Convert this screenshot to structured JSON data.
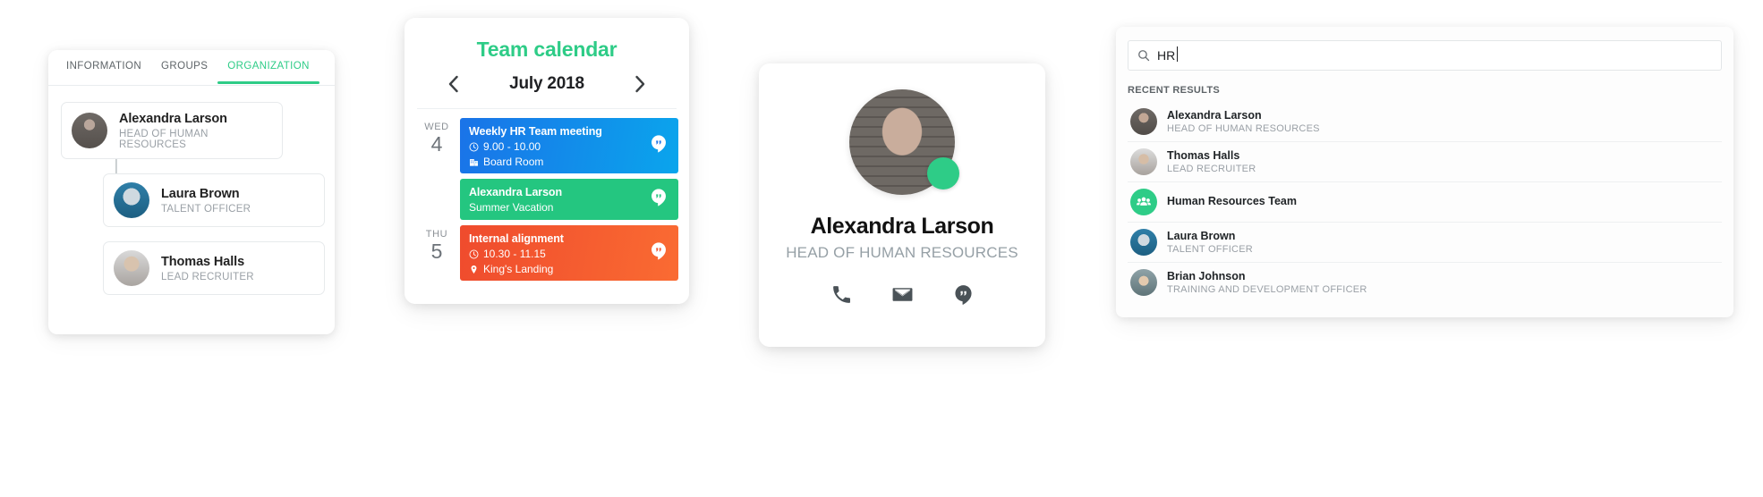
{
  "org_card": {
    "tabs": [
      {
        "label": "INFORMATION",
        "active": false
      },
      {
        "label": "GROUPS",
        "active": false
      },
      {
        "label": "ORGANIZATION",
        "active": true
      }
    ],
    "accent_color": "#2ecc87",
    "tree": [
      {
        "name": "Alexandra Larson",
        "role": "HEAD OF HUMAN RESOURCES",
        "level": 0
      },
      {
        "name": "Laura Brown",
        "role": "TALENT OFFICER",
        "level": 1
      },
      {
        "name": "Thomas Halls",
        "role": "LEAD RECRUITER",
        "level": 1
      }
    ]
  },
  "calendar": {
    "title": "Team calendar",
    "title_color": "#2ecc87",
    "month": "July 2018",
    "prev_icon": "chevron-left-icon",
    "next_icon": "chevron-right-icon",
    "days": [
      {
        "dow": "WED",
        "num": "4",
        "events": [
          {
            "title": "Weekly HR Team meeting",
            "time": "9.00 - 10.00",
            "location": "Board Room",
            "location_icon": "building-icon",
            "color": "#1a73e8",
            "style": "blue",
            "hangout": true
          },
          {
            "title": "Alexandra Larson",
            "time": "",
            "location": "Summer Vacation",
            "location_icon": "",
            "color": "#24c680",
            "style": "green",
            "hangout": true
          }
        ]
      },
      {
        "dow": "THU",
        "num": "5",
        "events": [
          {
            "title": "Internal alignment",
            "time": "10.30 - 11.15",
            "location": "King's Landing",
            "location_icon": "map-pin-icon",
            "color": "#ef4b2d",
            "style": "red",
            "hangout": true
          }
        ]
      }
    ]
  },
  "profile": {
    "name": "Alexandra Larson",
    "role": "HEAD OF HUMAN RESOURCES",
    "status_color": "#2ecc87",
    "actions": [
      {
        "icon": "phone-icon",
        "label": "Call"
      },
      {
        "icon": "mail-icon",
        "label": "Email"
      },
      {
        "icon": "hangouts-icon",
        "label": "Chat"
      }
    ]
  },
  "search": {
    "query": "HR",
    "placeholder": "Search",
    "search_icon": "search-icon",
    "section_label": "RECENT RESULTS",
    "results": [
      {
        "name": "Alexandra Larson",
        "role": "HEAD OF HUMAN RESOURCES",
        "type": "person"
      },
      {
        "name": "Thomas Halls",
        "role": "LEAD RECRUITER",
        "type": "person"
      },
      {
        "name": "Human Resources Team",
        "role": "",
        "type": "group"
      },
      {
        "name": "Laura Brown",
        "role": "TALENT OFFICER",
        "type": "person"
      },
      {
        "name": "Brian Johnson",
        "role": "TRAINING AND DEVELOPMENT OFFICER",
        "type": "person"
      }
    ]
  }
}
